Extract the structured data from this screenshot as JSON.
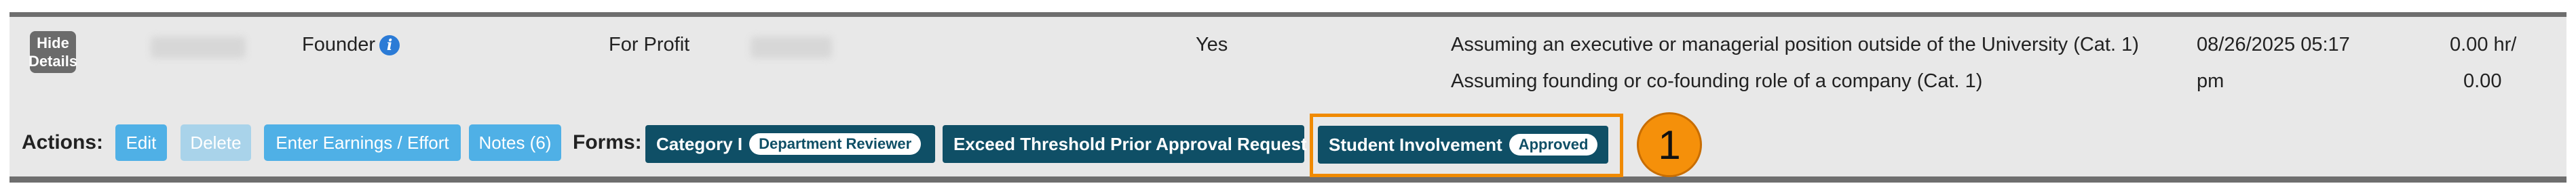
{
  "row": {
    "hide_details_label": "Hide Details",
    "role": "Founder",
    "entity_type": "For Profit",
    "answer": "Yes",
    "activities": [
      "Assuming an executive or managerial position outside of the University (Cat. 1)",
      "Assuming founding or co-founding role of a company (Cat. 1)"
    ],
    "date": "08/26/2025 05:17",
    "date_suffix": "pm",
    "hours_line1": "0.00 hr/",
    "hours_line2": "0.00"
  },
  "actions": {
    "label": "Actions:",
    "edit": "Edit",
    "delete": "Delete",
    "earnings": "Enter Earnings / Effort",
    "notes": "Notes (6)"
  },
  "forms": {
    "label": "Forms:",
    "category": {
      "label": "Category I",
      "badge": "Department Reviewer"
    },
    "exceed": {
      "label": "Exceed Threshold Prior Approval Request"
    },
    "student": {
      "label": "Student Involvement",
      "badge": "Approved"
    }
  },
  "callout": {
    "number": "1"
  },
  "colors": {
    "accent_orange": "#f08a00",
    "button_light": "#4fb0e6",
    "button_dark": "#0f4f66",
    "info_blue": "#2b7bd6"
  },
  "icons": {
    "info": "info-icon"
  }
}
